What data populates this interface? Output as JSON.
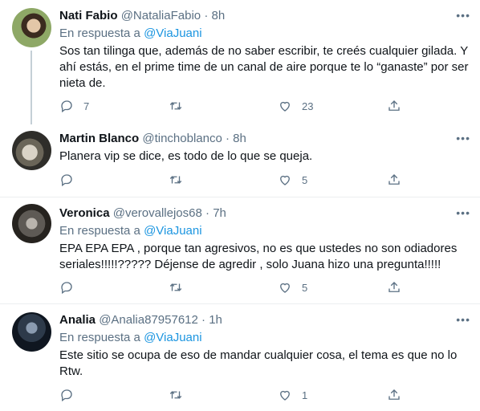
{
  "reply_prefix": "En respuesta a",
  "tweets": [
    {
      "name": "Nati Fabio",
      "handle": "@NataliaFabio",
      "time": "8h",
      "mention": "@ViaJuani",
      "text": "Sos tan tilinga que, además de no saber escribir, te creés cualquier gilada. Y ahí estás, en el prime time de un canal de aire porque te lo “ganaste” por ser nieta de.",
      "replies": "7",
      "retweets": "",
      "likes": "23"
    },
    {
      "name": "Martin Blanco",
      "handle": "@tinchoblanco",
      "time": "8h",
      "text": "Planera vip se dice, es todo de lo que se queja.",
      "replies": "",
      "retweets": "",
      "likes": "5"
    },
    {
      "name": "Veronica",
      "handle": "@verovallejos68",
      "time": "7h",
      "mention": "@ViaJuani",
      "text": "EPA EPA EPA , porque tan agresivos, no es que ustedes no son odiadores seriales!!!!!????? Déjense de agredir , solo Juana hizo una pregunta!!!!!",
      "replies": "",
      "retweets": "",
      "likes": "5"
    },
    {
      "name": "Analia",
      "handle": "@Analia87957612",
      "time": "1h",
      "mention": "@ViaJuani",
      "text": "Este sitio se ocupa de eso de mandar cualquier cosa, el tema es que no lo Rtw.",
      "replies": "",
      "retweets": "",
      "likes": "1"
    }
  ]
}
